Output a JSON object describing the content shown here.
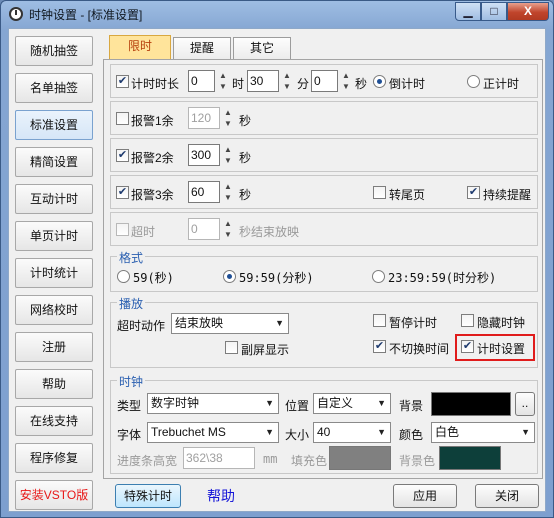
{
  "window": {
    "title": "时钟设置 - [标准设置]",
    "controls": {
      "minimize": "▁",
      "maximize": "□",
      "close": "X"
    }
  },
  "sidebar": {
    "items": [
      {
        "label": "随机抽签"
      },
      {
        "label": "名单抽签"
      },
      {
        "label": "标准设置"
      },
      {
        "label": "精简设置"
      },
      {
        "label": "互动计时"
      },
      {
        "label": "单页计时"
      },
      {
        "label": "计时统计"
      },
      {
        "label": "网络校时"
      },
      {
        "label": "注册"
      },
      {
        "label": "帮助"
      },
      {
        "label": "在线支持"
      },
      {
        "label": "程序修复"
      },
      {
        "label": "安装VSTO版"
      }
    ],
    "active_index": 2
  },
  "tabs": [
    {
      "label": "限时"
    },
    {
      "label": "提醒"
    },
    {
      "label": "其它"
    }
  ],
  "timer": {
    "enable_label": "计时时长",
    "hours": "0",
    "hours_unit": "时",
    "minutes": "30",
    "minutes_unit": "分",
    "seconds": "0",
    "seconds_unit": "秒",
    "countdown_label": "倒计时",
    "countup_label": "正计时",
    "enabled": true,
    "mode": "countdown"
  },
  "alarms": [
    {
      "label": "报警1余",
      "value": "120",
      "unit": "秒",
      "checked": false
    },
    {
      "label": "报警2余",
      "value": "300",
      "unit": "秒",
      "checked": true
    },
    {
      "label": "报警3余",
      "value": "60",
      "unit": "秒",
      "checked": true
    }
  ],
  "extra_options": {
    "tail_page_label": "转尾页",
    "tail_page_checked": false,
    "continuous_label": "持续提醒",
    "continuous_checked": true
  },
  "overtime": {
    "label": "超时",
    "value": "0",
    "suffix": "秒结束放映",
    "checked": false
  },
  "format": {
    "title": "格式",
    "options": [
      "59(秒)",
      "59:59(分秒)",
      "23:59:59(时分秒)"
    ],
    "selected_index": 1
  },
  "playback": {
    "title": "播放",
    "overtime_action_label": "超时动作",
    "overtime_action_value": "结束放映",
    "pause_label": "暂停计时",
    "pause_checked": false,
    "hide_clock_label": "隐藏时钟",
    "hide_clock_checked": false,
    "second_screen_label": "副屏显示",
    "second_screen_checked": false,
    "no_switch_label": "不切换时间",
    "no_switch_checked": true,
    "timer_settings_label": "计时设置",
    "timer_settings_checked": true
  },
  "clock": {
    "title": "时钟",
    "type_label": "类型",
    "type_value": "数字时钟",
    "position_label": "位置",
    "position_value": "自定义",
    "background_label": "背景",
    "background_color": "#000000",
    "browse_label": "..",
    "font_label": "字体",
    "font_value": "Trebuchet MS",
    "size_label": "大小",
    "size_value": "40",
    "color_label": "颜色",
    "color_value": "白色",
    "progress_label": "进度条高宽",
    "progress_value": "362\\38",
    "progress_unit": "mm",
    "fill_label": "填充色",
    "fill_color": "#808080",
    "bg_label": "背景色",
    "bg_color": "#0d3f3a"
  },
  "footer": {
    "special_timer": "特殊计时",
    "help_link": "帮助",
    "apply": "应用",
    "close": "关闭"
  },
  "colors": {
    "accent_tab": "#ffe49b",
    "link": "#1414d8",
    "highlight": "#e01b1b",
    "red_text": "#e81818"
  }
}
